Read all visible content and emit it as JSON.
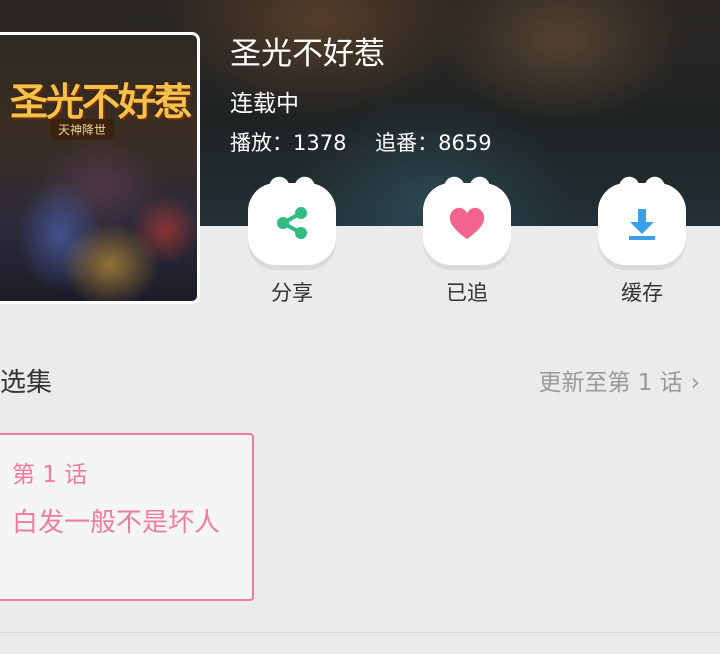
{
  "header": {
    "title": "圣光不好惹",
    "status": "连载中",
    "plays_label": "播放：1378",
    "follows_label": "追番：8659"
  },
  "poster": {
    "title": "圣光不好惹",
    "subtitle": "天神降世"
  },
  "actions": [
    {
      "label": "分享",
      "icon": "share-icon",
      "color": "#2ebd7e"
    },
    {
      "label": "已追",
      "icon": "heart-icon",
      "color": "#f3658f"
    },
    {
      "label": "缓存",
      "icon": "download-icon",
      "color": "#3a9ee8"
    }
  ],
  "episodes": {
    "title": "选集",
    "update_text": "更新至第 1 话",
    "chevron": "›",
    "items": [
      {
        "number": "第 1 话",
        "name": "白发一般不是坏人",
        "selected": true
      }
    ]
  },
  "colors": {
    "accent_pink": "#f07ca0",
    "background": "#ebebeb"
  }
}
